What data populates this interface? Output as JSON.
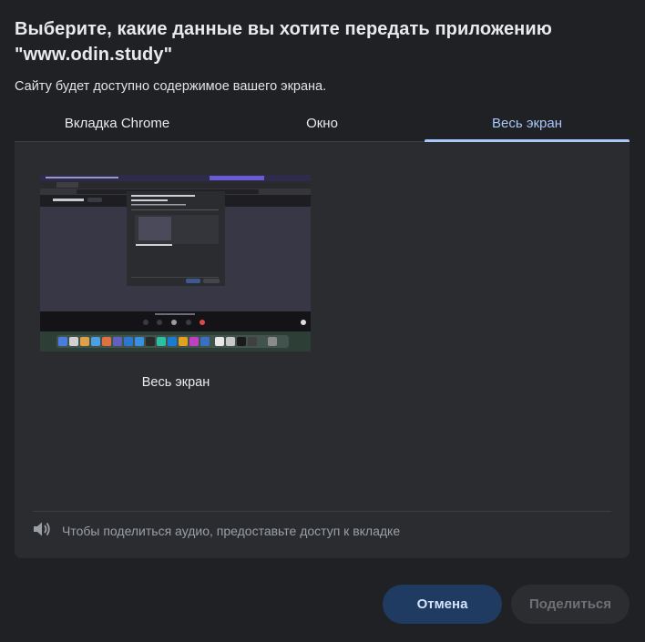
{
  "dialog": {
    "title": "Выберите, какие данные вы хотите передать приложению \"www.odin.study\"",
    "subtitle": "Сайту будет доступно содержимое вашего экрана."
  },
  "tabs": [
    {
      "label": "Вкладка Chrome",
      "active": false
    },
    {
      "label": "Окно",
      "active": false
    },
    {
      "label": "Весь экран",
      "active": true
    }
  ],
  "source": {
    "label": "Весь экран"
  },
  "audio": {
    "text": "Чтобы поделиться аудио, предоставьте доступ к вкладке",
    "icon": "speaker-icon"
  },
  "buttons": {
    "cancel": "Отмена",
    "share": "Поделиться"
  },
  "colors": {
    "background": "#202124",
    "accent": "#a8c7fa",
    "cancel_button": "#1f3b62"
  }
}
